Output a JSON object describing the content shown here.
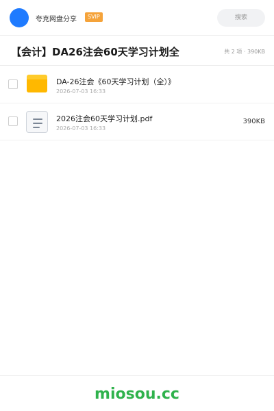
{
  "header": {
    "username": "夸克网盘分享",
    "badge": "SVIP",
    "search_placeholder": "搜索"
  },
  "folder": {
    "title": "【会计】DA26注会60天学习计划全",
    "summary": "共 2 项 · 390KB"
  },
  "files": [
    {
      "name": "DA-26注会《60天学习计划（全）》",
      "date": "2026-07-03 16:33",
      "size": "",
      "icon": "folder-icon"
    },
    {
      "name": "2026注会60天学习计划.pdf",
      "date": "2026-07-03 16:33",
      "size": "390KB",
      "icon": "document-icon"
    }
  ],
  "footer": {
    "brand": "miosou.cc"
  },
  "colors": {
    "accent": "#1f7bff",
    "svip": "#f5a33a",
    "folder": "#ffb800",
    "brand": "#2fb24c"
  }
}
